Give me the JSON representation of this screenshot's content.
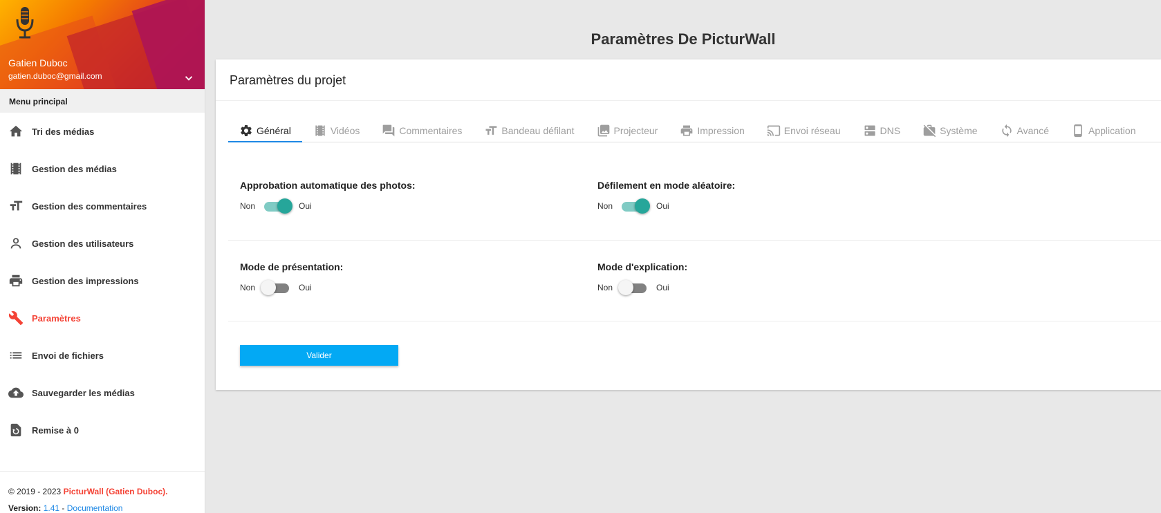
{
  "user": {
    "name": "Gatien Duboc",
    "email": "gatien.duboc@gmail.com"
  },
  "menu": {
    "header": "Menu principal",
    "items": [
      {
        "label": "Tri des médias",
        "icon": "home-icon"
      },
      {
        "label": "Gestion des médias",
        "icon": "film-icon"
      },
      {
        "label": "Gestion des commentaires",
        "icon": "text-size-icon"
      },
      {
        "label": "Gestion des utilisateurs",
        "icon": "person-icon"
      },
      {
        "label": "Gestion des impressions",
        "icon": "printer-icon"
      },
      {
        "label": "Paramètres",
        "icon": "wrench-icon",
        "active": true
      },
      {
        "label": "Envoi de fichiers",
        "icon": "list-icon"
      },
      {
        "label": "Sauvegarder les médias",
        "icon": "cloud-upload-icon"
      },
      {
        "label": "Remise à 0",
        "icon": "restore-icon"
      }
    ]
  },
  "footer": {
    "copyright": "© 2019 - 2023",
    "brand": "PicturWall (Gatien Duboc).",
    "version_label": "Version:",
    "version": "1.41",
    "separator": "-",
    "doc_link": "Documentation"
  },
  "page_title": "Paramètres De PicturWall",
  "card_title": "Paramètres du projet",
  "tabs": [
    {
      "label": "Général",
      "icon": "gear-icon",
      "active": true
    },
    {
      "label": "Vidéos",
      "icon": "film-icon"
    },
    {
      "label": "Commentaires",
      "icon": "comment-icon"
    },
    {
      "label": "Bandeau défilant",
      "icon": "text-size-icon"
    },
    {
      "label": "Projecteur",
      "icon": "image-icon"
    },
    {
      "label": "Impression",
      "icon": "printer-icon"
    },
    {
      "label": "Envoi réseau",
      "icon": "cast-icon"
    },
    {
      "label": "DNS",
      "icon": "dns-icon"
    },
    {
      "label": "Système",
      "icon": "work-off-icon"
    },
    {
      "label": "Avancé",
      "icon": "sync-icon"
    },
    {
      "label": "Application",
      "icon": "phone-icon"
    }
  ],
  "settings": [
    {
      "label": "Approbation automatique des photos:",
      "off": "Non",
      "on": "Oui",
      "value": true
    },
    {
      "label": "Défilement en mode aléatoire:",
      "off": "Non",
      "on": "Oui",
      "value": true
    },
    {
      "label": "Mode de présentation:",
      "off": "Non",
      "on": "Oui",
      "value": false
    },
    {
      "label": "Mode d'explication:",
      "off": "Non",
      "on": "Oui",
      "value": false
    }
  ],
  "submit_label": "Valider",
  "colors": {
    "accent": "#f44336",
    "primary": "#03a9f4",
    "toggle_on": "#26a69a",
    "tab_indicator": "#1e88e5"
  }
}
